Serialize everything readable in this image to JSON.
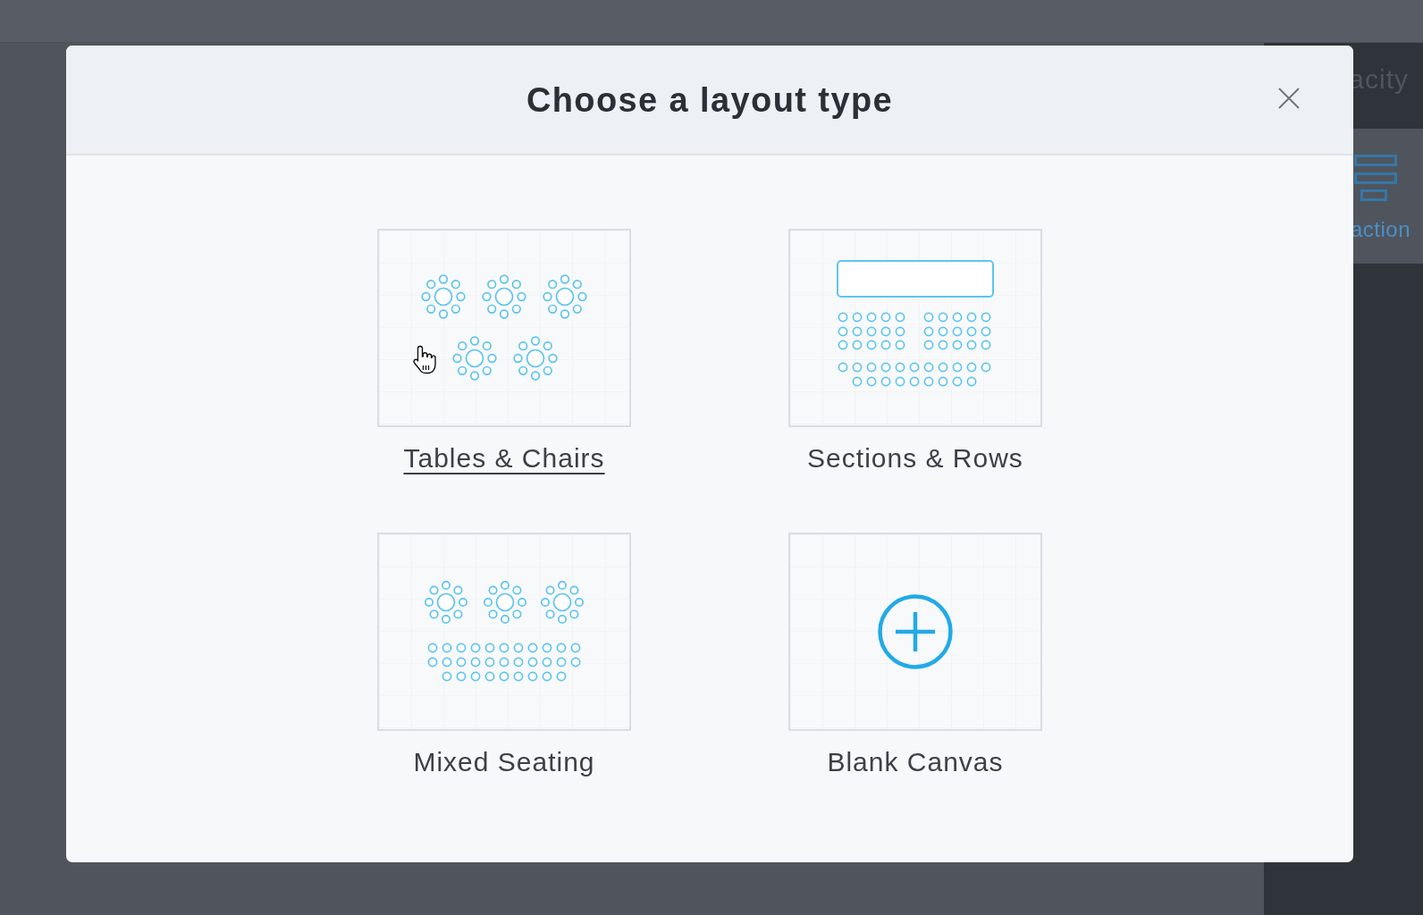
{
  "background": {
    "panel_heading": "acity",
    "panel_item": "action"
  },
  "dialog": {
    "title": "Choose a layout type",
    "options": [
      {
        "kind": "tables",
        "label": "Tables & Chairs",
        "hovered": true
      },
      {
        "kind": "sections",
        "label": "Sections & Rows",
        "hovered": false
      },
      {
        "kind": "mixed",
        "label": "Mixed Seating",
        "hovered": false
      },
      {
        "kind": "blank",
        "label": "Blank Canvas",
        "hovered": false
      }
    ]
  }
}
